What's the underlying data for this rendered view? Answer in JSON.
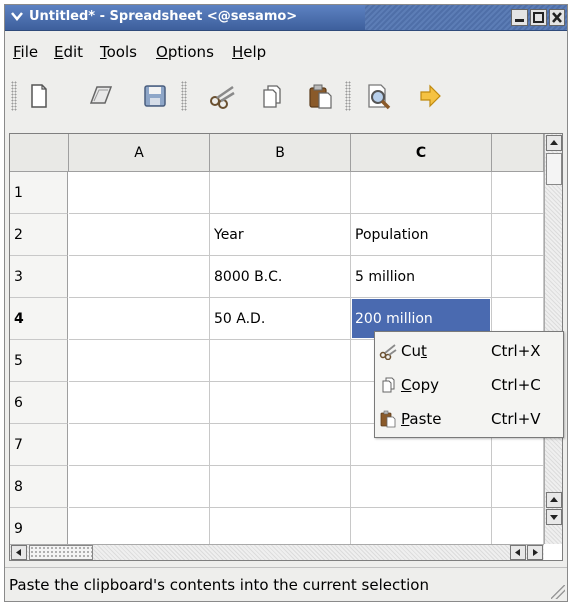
{
  "window": {
    "title": "Untitled* - Spreadsheet <@sesamo>",
    "minimize": "▁",
    "maximize": "□",
    "close": "✕"
  },
  "menubar": {
    "items": [
      {
        "label": "File",
        "mnemonic": "F"
      },
      {
        "label": "Edit",
        "mnemonic": "E"
      },
      {
        "label": "Tools",
        "mnemonic": "T"
      },
      {
        "label": "Options",
        "mnemonic": "O"
      },
      {
        "label": "Help",
        "mnemonic": "H"
      }
    ]
  },
  "toolbar": {
    "buttons": [
      "new-document-icon",
      "open-folder-icon",
      "save-disk-icon",
      "cut-scissors-icon",
      "copy-icon",
      "paste-icon",
      "print-preview-icon",
      "forward-arrow-icon"
    ]
  },
  "grid": {
    "columns": [
      "A",
      "B",
      "C",
      ""
    ],
    "rows": [
      "1",
      "2",
      "3",
      "4",
      "5",
      "6",
      "7",
      "8",
      "9"
    ],
    "cells": {
      "B2": "Year",
      "C2": "Population",
      "B3": "8000 B.C.",
      "C3": "5 million",
      "B4": "50 A.D.",
      "C4": "200 million"
    },
    "selected_cell": "C4",
    "selected_row": "4",
    "selected_column": "C",
    "selection_color": "#4a6ab0"
  },
  "context_menu": {
    "items": [
      {
        "label": "Cut",
        "mnemonic": "t",
        "shortcut": "Ctrl+X",
        "icon": "scissors-icon"
      },
      {
        "label": "Copy",
        "mnemonic": "C",
        "shortcut": "Ctrl+C",
        "icon": "copy-icon"
      },
      {
        "label": "Paste",
        "mnemonic": "P",
        "shortcut": "Ctrl+V",
        "icon": "paste-icon"
      }
    ]
  },
  "statusbar": {
    "text": "Paste the clipboard's contents into the current selection"
  }
}
